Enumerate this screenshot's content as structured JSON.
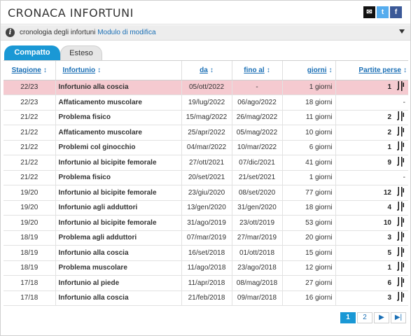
{
  "header": {
    "title": "CRONACA INFORTUNI",
    "share_icons": [
      "mail-icon",
      "twitter-icon",
      "facebook-icon"
    ]
  },
  "infobar": {
    "text": "cronologia degli infortuni",
    "link": "Modulo di modifica"
  },
  "tabs": [
    {
      "label": "Compatto",
      "active": true
    },
    {
      "label": "Esteso",
      "active": false
    }
  ],
  "table": {
    "columns": [
      "Stagione",
      "Infortunio",
      "da",
      "fino al",
      "giorni",
      "Partite perse"
    ],
    "sort_arrow": "↕",
    "rows": [
      {
        "season": "22/23",
        "injury": "Infortunio alla coscia",
        "from": "05/ott/2022",
        "to": "-",
        "days": "1 giorni",
        "games": "1",
        "club": true,
        "highlight": true
      },
      {
        "season": "22/23",
        "injury": "Affaticamento muscolare",
        "from": "19/lug/2022",
        "to": "06/ago/2022",
        "days": "18 giorni",
        "games": "-",
        "club": false,
        "highlight": false
      },
      {
        "season": "21/22",
        "injury": "Problema fisico",
        "from": "15/mag/2022",
        "to": "26/mag/2022",
        "days": "11 giorni",
        "games": "2",
        "club": true,
        "highlight": false
      },
      {
        "season": "21/22",
        "injury": "Affaticamento muscolare",
        "from": "25/apr/2022",
        "to": "05/mag/2022",
        "days": "10 giorni",
        "games": "2",
        "club": true,
        "highlight": false
      },
      {
        "season": "21/22",
        "injury": "Problemi col ginocchio",
        "from": "04/mar/2022",
        "to": "10/mar/2022",
        "days": "6 giorni",
        "games": "1",
        "club": true,
        "highlight": false
      },
      {
        "season": "21/22",
        "injury": "Infortunio al bicipite femorale",
        "from": "27/ott/2021",
        "to": "07/dic/2021",
        "days": "41 giorni",
        "games": "9",
        "club": true,
        "highlight": false
      },
      {
        "season": "21/22",
        "injury": "Problema fisico",
        "from": "20/set/2021",
        "to": "21/set/2021",
        "days": "1 giorni",
        "games": "-",
        "club": false,
        "highlight": false
      },
      {
        "season": "19/20",
        "injury": "Infortunio al bicipite femorale",
        "from": "23/giu/2020",
        "to": "08/set/2020",
        "days": "77 giorni",
        "games": "12",
        "club": true,
        "highlight": false
      },
      {
        "season": "19/20",
        "injury": "Infortunio agli adduttori",
        "from": "13/gen/2020",
        "to": "31/gen/2020",
        "days": "18 giorni",
        "games": "4",
        "club": true,
        "highlight": false
      },
      {
        "season": "19/20",
        "injury": "Infortunio al bicipite femorale",
        "from": "31/ago/2019",
        "to": "23/ott/2019",
        "days": "53 giorni",
        "games": "10",
        "club": true,
        "highlight": false
      },
      {
        "season": "18/19",
        "injury": "Problema agli adduttori",
        "from": "07/mar/2019",
        "to": "27/mar/2019",
        "days": "20 giorni",
        "games": "3",
        "club": true,
        "highlight": false
      },
      {
        "season": "18/19",
        "injury": "Infortunio alla coscia",
        "from": "16/set/2018",
        "to": "01/ott/2018",
        "days": "15 giorni",
        "games": "5",
        "club": true,
        "highlight": false
      },
      {
        "season": "18/19",
        "injury": "Problema muscolare",
        "from": "11/ago/2018",
        "to": "23/ago/2018",
        "days": "12 giorni",
        "games": "1",
        "club": true,
        "highlight": false
      },
      {
        "season": "17/18",
        "injury": "Infortunio al piede",
        "from": "11/apr/2018",
        "to": "08/mag/2018",
        "days": "27 giorni",
        "games": "6",
        "club": true,
        "highlight": false
      },
      {
        "season": "17/18",
        "injury": "Infortunio alla coscia",
        "from": "21/feb/2018",
        "to": "09/mar/2018",
        "days": "16 giorni",
        "games": "3",
        "club": true,
        "highlight": false
      }
    ]
  },
  "pager": {
    "pages": [
      "1",
      "2"
    ],
    "active": "1",
    "next": "▶",
    "last": "▶|"
  },
  "colors": {
    "accent": "#1a98d5",
    "link": "#1a6fb5",
    "highlight_row": "#f5cad0"
  }
}
